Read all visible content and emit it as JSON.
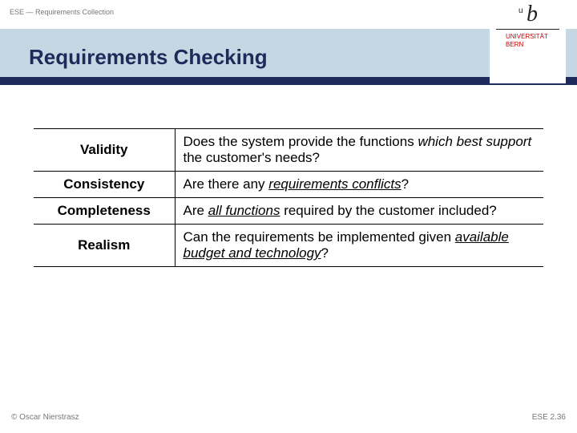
{
  "header": {
    "label": "ESE — Requirements Collection"
  },
  "title": "Requirements Checking",
  "logo": {
    "b": "b",
    "u": "u",
    "line1": "UNIVERSITÄT",
    "line2": "BERN"
  },
  "rows": [
    {
      "label": "Validity",
      "q_pre": "Does the system provide the functions ",
      "q_em": "which best support",
      "q_post": " the customer's needs?"
    },
    {
      "label": "Consistency",
      "q_pre": "Are there any ",
      "q_em": "requirements conflicts",
      "q_post": "?"
    },
    {
      "label": "Completeness",
      "q_pre": "Are ",
      "q_em": "all functions",
      "q_post": " required by the customer included?"
    },
    {
      "label": "Realism",
      "q_pre": "Can the requirements be implemented given ",
      "q_em": "available budget and technology",
      "q_post": "?"
    }
  ],
  "footer": {
    "left": "© Oscar Nierstrasz",
    "right": "ESE 2.36"
  }
}
